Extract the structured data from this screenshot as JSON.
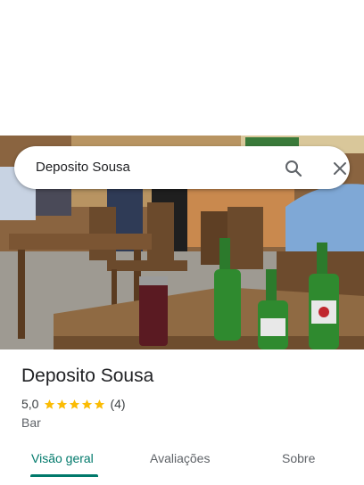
{
  "search": {
    "query": "Deposito Sousa"
  },
  "place": {
    "name": "Deposito Sousa",
    "rating": "5,0",
    "stars": 5,
    "review_count": "(4)",
    "category": "Bar"
  },
  "tabs": [
    {
      "label": "Visão geral",
      "active": true
    },
    {
      "label": "Avaliações",
      "active": false
    },
    {
      "label": "Sobre",
      "active": false
    }
  ],
  "colors": {
    "accent": "#00796b",
    "star": "#fbbc04",
    "text_primary": "#202124",
    "text_secondary": "#5f6368"
  },
  "icons": {
    "search": "search-icon",
    "close": "close-icon",
    "star": "star-icon"
  }
}
